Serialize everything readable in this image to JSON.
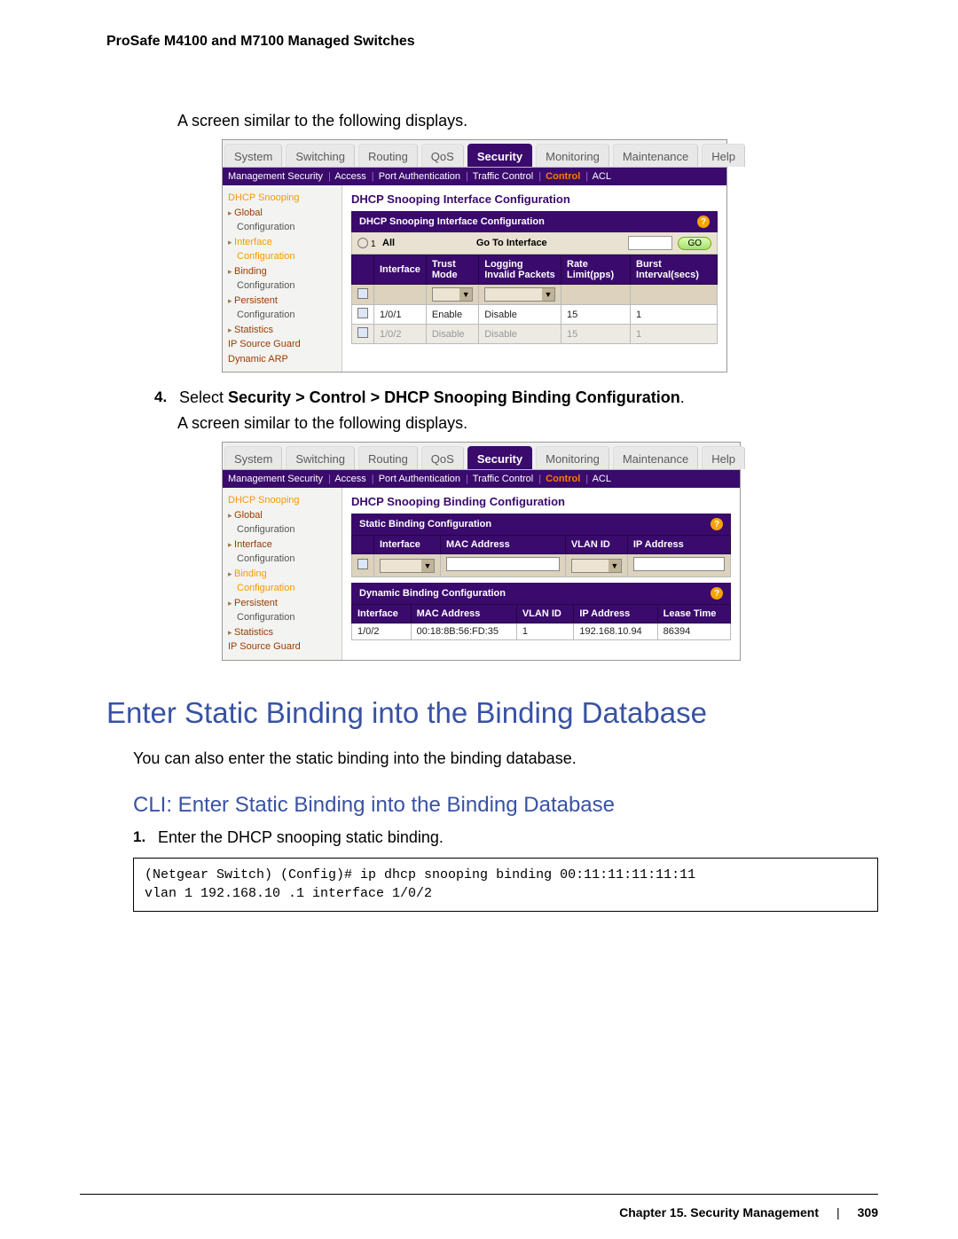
{
  "doc_header": "ProSafe M4100 and M7100 Managed Switches",
  "intro_text_1": "A screen similar to the following displays.",
  "step4": {
    "num": "4.",
    "pre": "Select ",
    "bold": "Security > Control > DHCP Snooping Binding Configuration",
    "post": "."
  },
  "intro_text_2": "A screen similar to the following displays.",
  "tabs": [
    "System",
    "Switching",
    "Routing",
    "QoS",
    "Security",
    "Monitoring",
    "Maintenance",
    "Help"
  ],
  "subtabs": [
    "Management Security",
    "Access",
    "Port Authentication",
    "Traffic Control",
    "Control",
    "ACL"
  ],
  "shot1": {
    "panel_title": "DHCP Snooping Interface Configuration",
    "box_title": "DHCP Snooping Interface Configuration",
    "all_label": "All",
    "go_label": "Go To Interface",
    "go_btn": "GO",
    "sidebar": {
      "dhcp": "DHCP Snooping",
      "global": "Global",
      "global_cfg": "Configuration",
      "interface": "Interface",
      "interface_cfg": "Configuration",
      "binding": "Binding",
      "binding_cfg": "Configuration",
      "persistent": "Persistent",
      "persistent_cfg": "Configuration",
      "stats": "Statistics",
      "ipsg": "IP Source Guard",
      "darp": "Dynamic ARP"
    },
    "headers": [
      "",
      "Interface",
      "Trust Mode",
      "Logging Invalid Packets",
      "Rate Limit(pps)",
      "Burst Interval(secs)"
    ],
    "rows": [
      {
        "iface": "1/0/1",
        "trust": "Enable",
        "log": "Disable",
        "rate": "15",
        "burst": "1",
        "dim": false
      },
      {
        "iface": "1/0/2",
        "trust": "Disable",
        "log": "Disable",
        "rate": "15",
        "burst": "1",
        "dim": true
      }
    ]
  },
  "shot2": {
    "panel_title": "DHCP Snooping Binding Configuration",
    "static_title": "Static Binding Configuration",
    "dynamic_title": "Dynamic Binding Configuration",
    "sidebar": {
      "dhcp": "DHCP Snooping",
      "global": "Global",
      "global_cfg": "Configuration",
      "interface": "Interface",
      "interface_cfg": "Configuration",
      "binding": "Binding",
      "binding_cfg": "Configuration",
      "persistent": "Persistent",
      "persistent_cfg": "Configuration",
      "stats": "Statistics",
      "ipsg": "IP Source Guard"
    },
    "static_headers": [
      "",
      "Interface",
      "MAC Address",
      "VLAN ID",
      "IP Address"
    ],
    "dyn_headers": [
      "Interface",
      "MAC Address",
      "VLAN ID",
      "IP Address",
      "Lease Time"
    ],
    "dyn_row": {
      "iface": "1/0/2",
      "mac": "00:18:8B:56:FD:35",
      "vlan": "1",
      "ip": "192.168.10.94",
      "lease": "86394"
    }
  },
  "h1": "Enter Static Binding into the Binding Database",
  "h1_body": "You can also enter the static binding into the binding database.",
  "h2": "CLI: Enter Static Binding into the Binding Database",
  "cli_step": {
    "num": "1.",
    "text": "Enter the DHCP snooping static binding."
  },
  "cli_code": "(Netgear Switch) (Config)# ip dhcp snooping binding 00:11:11:11:11:11\nvlan 1 192.168.10 .1 interface 1/0/2",
  "footer": {
    "chapter": "Chapter 15.  Security Management",
    "sep": "|",
    "page": "309"
  }
}
